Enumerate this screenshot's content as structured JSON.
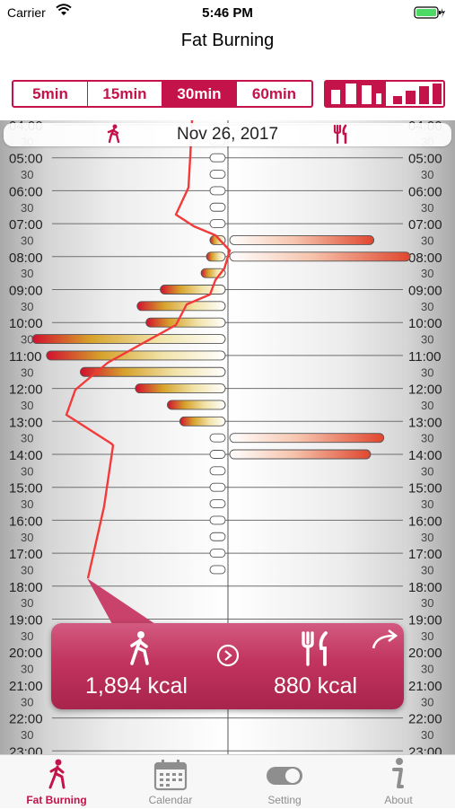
{
  "status": {
    "carrier": "Carrier",
    "time": "5:46 PM"
  },
  "nav": {
    "title": "Fat Burning"
  },
  "interval_options": [
    "5min",
    "15min",
    "30min",
    "60min"
  ],
  "selected_interval": "30min",
  "chart_toggle": {
    "selected": "bars-grouped",
    "options": [
      "bars-grouped",
      "bars-ascending"
    ]
  },
  "date": "Nov 26, 2017",
  "hour_labels": [
    "04:00",
    "05:00",
    "06:00",
    "07:00",
    "08:00",
    "09:00",
    "10:00",
    "11:00",
    "12:00",
    "13:00",
    "14:00",
    "15:00",
    "16:00",
    "17:00",
    "18:00",
    "19:00",
    "20:00",
    "21:00",
    "22:00",
    "23:00"
  ],
  "half_label": "30",
  "summary": {
    "burned_kcal": "1,894 kcal",
    "intake_kcal": "880 kcal"
  },
  "tabs": [
    {
      "label": "Fat Burning",
      "icon": "walking-person-icon"
    },
    {
      "label": "Calendar",
      "icon": "calendar-icon"
    },
    {
      "label": "Setting",
      "icon": "toggle-icon"
    },
    {
      "label": "About",
      "icon": "info-icon"
    }
  ],
  "colors": {
    "accent": "#c4124a",
    "line": "#f23a3a"
  },
  "chart_data": {
    "type": "bar",
    "title": "",
    "x_unit": "half-hour slot",
    "activity_bars": [
      {
        "time": "07:30",
        "level": 0.0
      },
      {
        "time": "08:00",
        "level": 0.02
      },
      {
        "time": "08:30",
        "level": 0.05
      },
      {
        "time": "09:00",
        "level": 0.28
      },
      {
        "time": "09:30",
        "level": 0.41
      },
      {
        "time": "10:00",
        "level": 0.36
      },
      {
        "time": "10:30",
        "level": 1.0
      },
      {
        "time": "11:00",
        "level": 0.92
      },
      {
        "time": "11:30",
        "level": 0.73
      },
      {
        "time": "12:00",
        "level": 0.42
      },
      {
        "time": "12:30",
        "level": 0.24
      },
      {
        "time": "13:00",
        "level": 0.17
      }
    ],
    "meal_bars": [
      {
        "time": "07:30",
        "level": 0.78
      },
      {
        "time": "08:00",
        "level": 1.0
      },
      {
        "time": "13:30",
        "level": 0.84
      },
      {
        "time": "14:00",
        "level": 0.76
      }
    ]
  }
}
